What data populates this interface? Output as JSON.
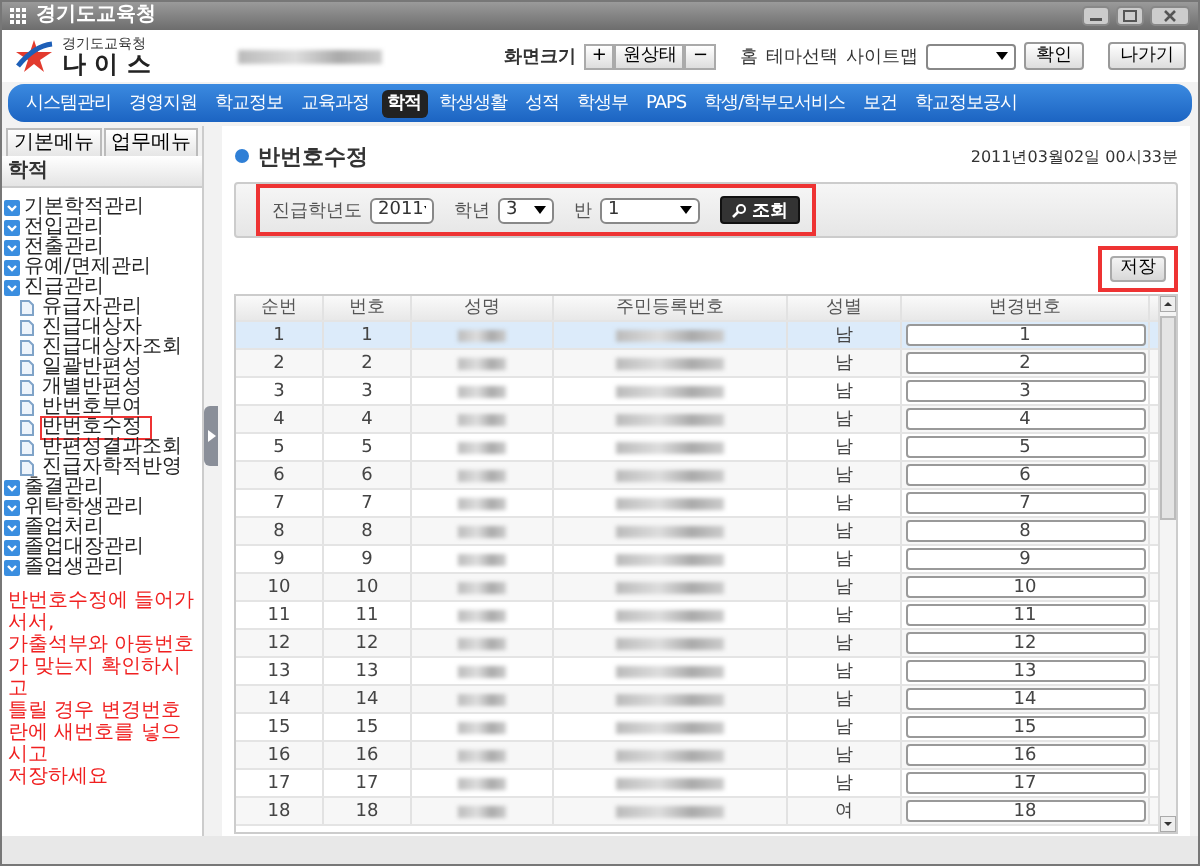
{
  "window": {
    "title": "경기도교육청"
  },
  "header": {
    "org": "경기도교육청",
    "logo_text": "나 이 스",
    "zoom_label": "화면크기",
    "zoom_buttons": [
      "+",
      "원상태",
      "−"
    ],
    "links": [
      "홈",
      "테마선택",
      "사이트맵"
    ],
    "confirm": "확인",
    "exit": "나가기"
  },
  "nav": [
    {
      "label": "시스템관리",
      "selected": false
    },
    {
      "label": "경영지원",
      "selected": false
    },
    {
      "label": "학교정보",
      "selected": false
    },
    {
      "label": "교육과정",
      "selected": false
    },
    {
      "label": "학적",
      "selected": true
    },
    {
      "label": "학생생활",
      "selected": false
    },
    {
      "label": "성적",
      "selected": false
    },
    {
      "label": "학생부",
      "selected": false
    },
    {
      "label": "PAPS",
      "selected": false
    },
    {
      "label": "학생/학부모서비스",
      "selected": false
    },
    {
      "label": "보건",
      "selected": false
    },
    {
      "label": "학교정보공시",
      "selected": false
    }
  ],
  "sidebar": {
    "tabs": [
      "기본메뉴",
      "업무메뉴"
    ],
    "section": "학적",
    "items": [
      {
        "label": "기본학적관리",
        "annotated": false
      },
      {
        "label": "전입관리",
        "annotated": false
      },
      {
        "label": "전출관리",
        "annotated": false
      },
      {
        "label": "유예/면제관리",
        "annotated": false
      },
      {
        "label": "진급관리",
        "annotated": false,
        "children": [
          {
            "label": "유급자관리",
            "annotated": false
          },
          {
            "label": "진급대상자",
            "annotated": false
          },
          {
            "label": "진급대상자조회",
            "annotated": false
          },
          {
            "label": "일괄반편성",
            "annotated": false
          },
          {
            "label": "개별반편성",
            "annotated": false
          },
          {
            "label": "반번호부여",
            "annotated": false
          },
          {
            "label": "반번호수정",
            "annotated": true
          },
          {
            "label": "반편성결과조회",
            "annotated": false
          },
          {
            "label": "진급자학적반영",
            "annotated": false
          }
        ]
      },
      {
        "label": "출결관리",
        "annotated": false
      },
      {
        "label": "위탁학생관리",
        "annotated": false
      },
      {
        "label": "졸업처리",
        "annotated": false
      },
      {
        "label": "졸업대장관리",
        "annotated": false
      },
      {
        "label": "졸업생관리",
        "annotated": false
      }
    ]
  },
  "page": {
    "title": "반번호수정",
    "datetime": "2011년03월02일 00시33분"
  },
  "filter": {
    "annotated": true,
    "fields": [
      {
        "label": "진급학년도",
        "value": "2011"
      },
      {
        "label": "학년",
        "value": "3"
      },
      {
        "label": "반",
        "value": "1"
      }
    ],
    "search_button": "조회"
  },
  "save_button": {
    "label": "저장",
    "annotated": true
  },
  "table": {
    "columns": [
      "순번",
      "번호",
      "성명",
      "주민등록번호",
      "성별",
      "변경번호"
    ],
    "rows": [
      {
        "seq": "1",
        "no": "1",
        "gender": "남",
        "new_no": "1",
        "selected": true
      },
      {
        "seq": "2",
        "no": "2",
        "gender": "남",
        "new_no": "2",
        "selected": false
      },
      {
        "seq": "3",
        "no": "3",
        "gender": "남",
        "new_no": "3",
        "selected": false
      },
      {
        "seq": "4",
        "no": "4",
        "gender": "남",
        "new_no": "4",
        "selected": false
      },
      {
        "seq": "5",
        "no": "5",
        "gender": "남",
        "new_no": "5",
        "selected": false
      },
      {
        "seq": "6",
        "no": "6",
        "gender": "남",
        "new_no": "6",
        "selected": false
      },
      {
        "seq": "7",
        "no": "7",
        "gender": "남",
        "new_no": "7",
        "selected": false
      },
      {
        "seq": "8",
        "no": "8",
        "gender": "남",
        "new_no": "8",
        "selected": false
      },
      {
        "seq": "9",
        "no": "9",
        "gender": "남",
        "new_no": "9",
        "selected": false
      },
      {
        "seq": "10",
        "no": "10",
        "gender": "남",
        "new_no": "10",
        "selected": false
      },
      {
        "seq": "11",
        "no": "11",
        "gender": "남",
        "new_no": "11",
        "selected": false
      },
      {
        "seq": "12",
        "no": "12",
        "gender": "남",
        "new_no": "12",
        "selected": false
      },
      {
        "seq": "13",
        "no": "13",
        "gender": "남",
        "new_no": "13",
        "selected": false
      },
      {
        "seq": "14",
        "no": "14",
        "gender": "남",
        "new_no": "14",
        "selected": false
      },
      {
        "seq": "15",
        "no": "15",
        "gender": "남",
        "new_no": "15",
        "selected": false
      },
      {
        "seq": "16",
        "no": "16",
        "gender": "남",
        "new_no": "16",
        "selected": false
      },
      {
        "seq": "17",
        "no": "17",
        "gender": "남",
        "new_no": "17",
        "selected": false
      },
      {
        "seq": "18",
        "no": "18",
        "gender": "여",
        "new_no": "18",
        "selected": false
      }
    ]
  },
  "annotation": {
    "lines": [
      "반번호수정에 들어가서서,",
      "가출석부와 아동번호가 맞는지 확인하시고",
      "틀릴 경우 변경번호란에 새번호를 넣으시고",
      "저장하세요"
    ]
  }
}
